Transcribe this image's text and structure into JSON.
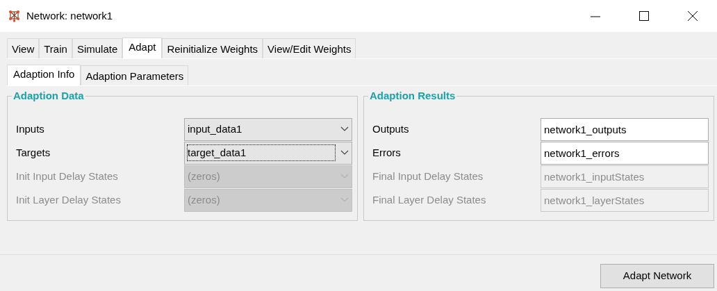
{
  "window": {
    "title": "Network: network1"
  },
  "tabs": [
    {
      "label": "View",
      "selected": false
    },
    {
      "label": "Train",
      "selected": false
    },
    {
      "label": "Simulate",
      "selected": false
    },
    {
      "label": "Adapt",
      "selected": true
    },
    {
      "label": "Reinitialize Weights",
      "selected": false
    },
    {
      "label": "View/Edit Weights",
      "selected": false
    }
  ],
  "subtabs": [
    {
      "label": "Adaption Info",
      "selected": true
    },
    {
      "label": "Adaption Parameters",
      "selected": false
    }
  ],
  "panels": [
    {
      "title": "Adaption Data",
      "rows": [
        {
          "label": "Inputs",
          "kind": "dropdown",
          "value": "input_data1",
          "disabled": false,
          "focused": false
        },
        {
          "label": "Targets",
          "kind": "dropdown",
          "value": "target_data1",
          "disabled": false,
          "focused": true
        },
        {
          "label": "Init Input Delay States",
          "kind": "dropdown",
          "value": "(zeros)",
          "disabled": true,
          "focused": false
        },
        {
          "label": "Init Layer Delay States",
          "kind": "dropdown",
          "value": "(zeros)",
          "disabled": true,
          "focused": false
        }
      ]
    },
    {
      "title": "Adaption Results",
      "rows": [
        {
          "label": "Outputs",
          "kind": "text",
          "value": "network1_outputs",
          "disabled": false
        },
        {
          "label": "Errors",
          "kind": "text",
          "value": "network1_errors",
          "disabled": false
        },
        {
          "label": "Final Input Delay States",
          "kind": "text",
          "value": "network1_inputStates",
          "disabled": true
        },
        {
          "label": "Final Layer Delay States",
          "kind": "text",
          "value": "network1_layerStates",
          "disabled": true
        }
      ]
    }
  ],
  "action_button": "Adapt Network"
}
